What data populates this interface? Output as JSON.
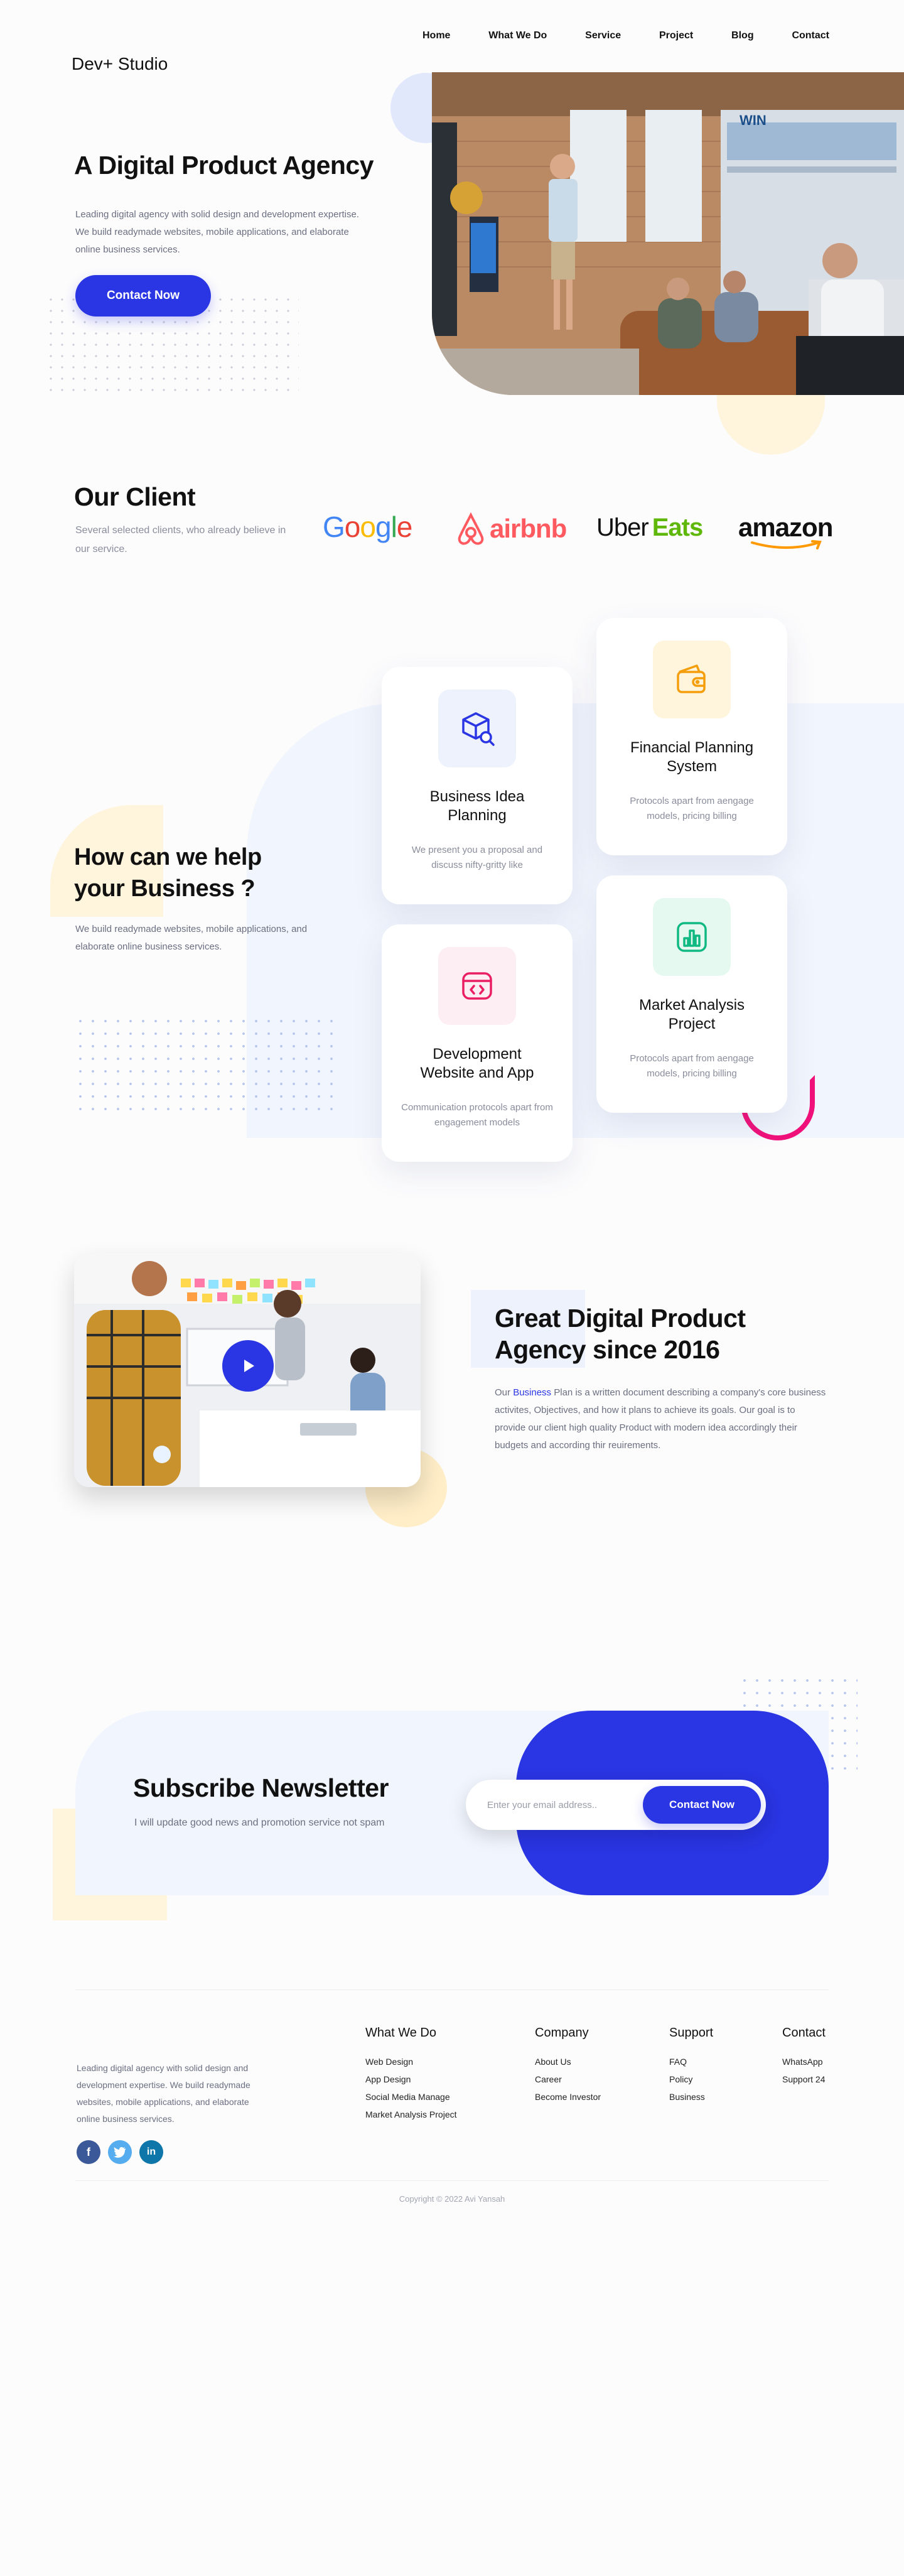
{
  "brand": "Dev+ Studio",
  "nav": [
    "Home",
    "What We Do",
    "Service",
    "Project",
    "Blog",
    "Contact"
  ],
  "hero": {
    "title": "A Digital Product Agency",
    "description": "Leading digital agency with solid design and development expertise. We build readymade websites, mobile applications, and elaborate online business services.",
    "cta": "Contact Now",
    "image_sign": "WIN"
  },
  "clients": {
    "title": "Our Client",
    "description": "Several selected clients, who already believe in our service.",
    "logos": {
      "google": "Google",
      "airbnb": "airbnb",
      "uber": "Uber",
      "eats": "Eats",
      "amazon": "amazon"
    },
    "colors": {
      "airbnb": "#ff5a5f",
      "eats": "#5fb709"
    }
  },
  "services": {
    "title": "How can we help your Business ?",
    "description": "We build readymade websites, mobile applications, and elaborate online business services.",
    "cards": [
      {
        "title": "Business Idea Planning",
        "description": "We present you a proposal and discuss nifty-gritty like",
        "icon": "box-search-icon",
        "color": "#2a35e3",
        "bg": "#eef2fd"
      },
      {
        "title": "Financial Planning System",
        "description": "Protocols apart from aengage models, pricing billing",
        "icon": "wallet-icon",
        "color": "#f59e0b",
        "bg": "#fff4dc"
      },
      {
        "title": "Development Website and App",
        "description": "Communication protocols apart from engagement models",
        "icon": "code-window-icon",
        "color": "#e91e63",
        "bg": "#fdeef4"
      },
      {
        "title": "Market Analysis Project",
        "description": "Protocols apart from aengage models, pricing billing",
        "icon": "chart-icon",
        "color": "#10b981",
        "bg": "#e6f9f1"
      }
    ]
  },
  "about": {
    "title": "Great Digital Product Agency since 2016",
    "description_prefix": "Our ",
    "description_highlight": "Business",
    "description_rest": " Plan is a written document describing a company's core business activites, Objectives, and how it plans to achieve its goals. Our goal is to provide our client high quality Product with modern idea accordingly their budgets and according thir reuirements.",
    "accent": "#2a35e3"
  },
  "newsletter": {
    "title": "Subscribe Newsletter",
    "description": "I will update good news and promotion service not spam",
    "placeholder": "Enter your email address..",
    "button": "Contact Now"
  },
  "footer": {
    "description": "Leading digital agency with solid design and development expertise. We build readymade websites, mobile applications, and elaborate online business services.",
    "socials": [
      "facebook-icon",
      "twitter-icon",
      "linkedin-icon"
    ],
    "columns": [
      {
        "title": "What We Do",
        "items": [
          "Web Design",
          "App Design",
          "Social Media Manage",
          "Market Analysis Project"
        ]
      },
      {
        "title": "Company",
        "items": [
          "About Us",
          "Career",
          "Become Investor"
        ]
      },
      {
        "title": "Support",
        "items": [
          "FAQ",
          "Policy",
          "Business"
        ]
      },
      {
        "title": "Contact",
        "items": [
          "WhatsApp",
          "Support 24"
        ]
      }
    ],
    "copyright": "Copyright © 2022 Avi Yansah"
  }
}
